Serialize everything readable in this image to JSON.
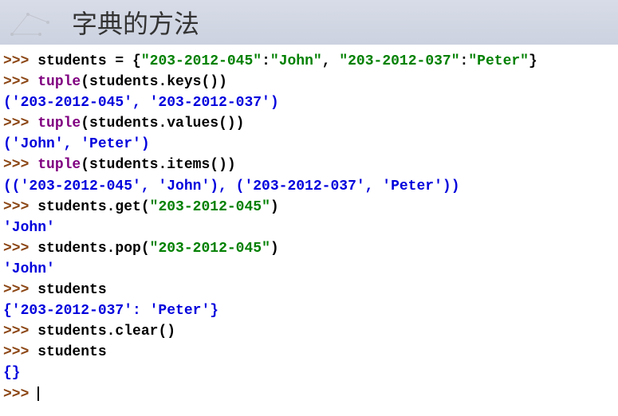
{
  "title": "字典的方法",
  "lines": [
    {
      "type": "input",
      "prompt": ">>> ",
      "tokens": [
        {
          "t": "students = {",
          "c": "keyword"
        },
        {
          "t": "\"203-2012-045\"",
          "c": "string"
        },
        {
          "t": ":",
          "c": "keyword"
        },
        {
          "t": "\"John\"",
          "c": "string"
        },
        {
          "t": ", ",
          "c": "keyword"
        },
        {
          "t": "\"203-2012-037\"",
          "c": "string"
        },
        {
          "t": ":",
          "c": "keyword"
        },
        {
          "t": "\"Peter\"",
          "c": "string"
        },
        {
          "t": "}",
          "c": "keyword"
        }
      ]
    },
    {
      "type": "input",
      "prompt": ">>> ",
      "tokens": [
        {
          "t": "tuple",
          "c": "func"
        },
        {
          "t": "(students.keys())",
          "c": "keyword"
        }
      ]
    },
    {
      "type": "output",
      "text": "('203-2012-045', '203-2012-037')"
    },
    {
      "type": "input",
      "prompt": ">>> ",
      "tokens": [
        {
          "t": "tuple",
          "c": "func"
        },
        {
          "t": "(students.values())",
          "c": "keyword"
        }
      ]
    },
    {
      "type": "output",
      "text": "('John', 'Peter')"
    },
    {
      "type": "input",
      "prompt": ">>> ",
      "tokens": [
        {
          "t": "tuple",
          "c": "func"
        },
        {
          "t": "(students.items())",
          "c": "keyword"
        }
      ]
    },
    {
      "type": "output",
      "text": "(('203-2012-045', 'John'), ('203-2012-037', 'Peter'))"
    },
    {
      "type": "input",
      "prompt": ">>> ",
      "tokens": [
        {
          "t": "students.get(",
          "c": "keyword"
        },
        {
          "t": "\"203-2012-045\"",
          "c": "string"
        },
        {
          "t": ")",
          "c": "keyword"
        }
      ]
    },
    {
      "type": "output",
      "text": "'John'"
    },
    {
      "type": "input",
      "prompt": ">>> ",
      "tokens": [
        {
          "t": "students.pop(",
          "c": "keyword"
        },
        {
          "t": "\"203-2012-045\"",
          "c": "string"
        },
        {
          "t": ")",
          "c": "keyword"
        }
      ]
    },
    {
      "type": "output",
      "text": "'John'"
    },
    {
      "type": "input",
      "prompt": ">>> ",
      "tokens": [
        {
          "t": "students",
          "c": "keyword"
        }
      ]
    },
    {
      "type": "output",
      "text": "{'203-2012-037': 'Peter'}"
    },
    {
      "type": "input",
      "prompt": ">>> ",
      "tokens": [
        {
          "t": "students.clear()",
          "c": "keyword"
        }
      ]
    },
    {
      "type": "input",
      "prompt": ">>> ",
      "tokens": [
        {
          "t": "students",
          "c": "keyword"
        }
      ]
    },
    {
      "type": "output",
      "text": "{}"
    },
    {
      "type": "cursor",
      "prompt": ">>> "
    }
  ]
}
